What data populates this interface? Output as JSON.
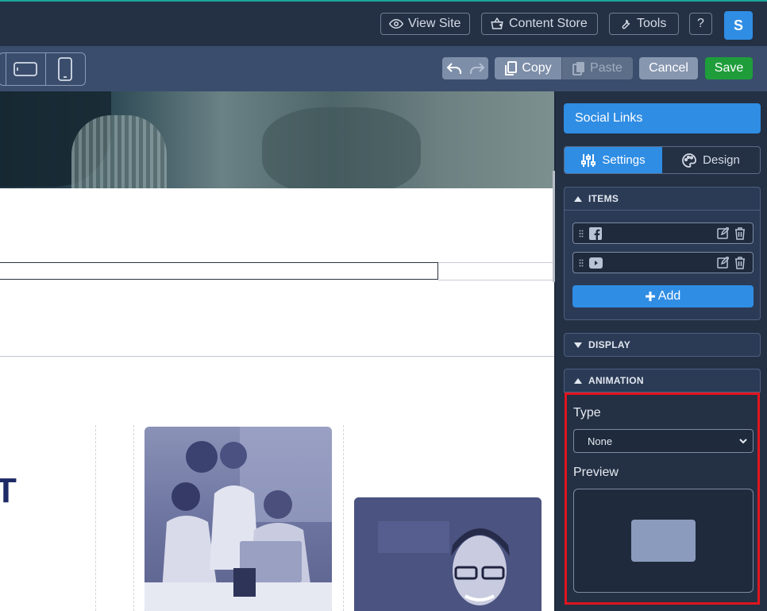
{
  "topbar": {
    "view_site": "View Site",
    "content_store": "Content Store",
    "tools": "Tools",
    "help": "?",
    "avatar_letter": "S"
  },
  "toolbar": {
    "copy": "Copy",
    "paste": "Paste",
    "cancel": "Cancel",
    "save": "Save"
  },
  "canvas": {
    "partial_heading": "T"
  },
  "panel": {
    "title": "Social Links",
    "tabs": [
      {
        "label": "Settings",
        "active": true
      },
      {
        "label": "Design",
        "active": false
      }
    ],
    "sections": {
      "items": {
        "heading": "ITEMS",
        "rows": [
          {
            "icon": "facebook-icon"
          },
          {
            "icon": "youtube-icon"
          }
        ],
        "add_label": "Add"
      },
      "display": {
        "heading": "DISPLAY"
      },
      "animation": {
        "heading": "ANIMATION",
        "type_label": "Type",
        "type_value": "None",
        "preview_label": "Preview"
      }
    }
  },
  "colors": {
    "accent": "#2f8de4",
    "save": "#1e9d3a",
    "highlight": "#e0151f"
  }
}
